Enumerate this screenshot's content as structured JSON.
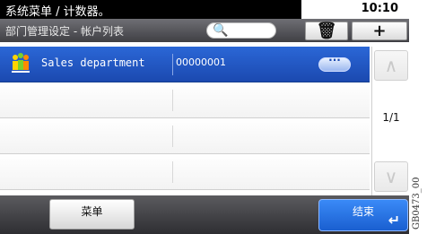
{
  "title_bar": {
    "title": "系统菜单 / 计数器。",
    "time": "10:10"
  },
  "header": {
    "subtitle": "部门管理设定 - 帐户列表",
    "search_icon": "search-icon",
    "trash_icon": "trash-icon",
    "add_icon": "plus-icon"
  },
  "accounts": {
    "rows": [
      {
        "name": "Sales department",
        "number": "00000001",
        "selected": true
      },
      {
        "name": "",
        "number": "",
        "selected": false
      },
      {
        "name": "",
        "number": "",
        "selected": false
      },
      {
        "name": "",
        "number": "",
        "selected": false
      }
    ]
  },
  "scroll": {
    "page_indicator": "1/1",
    "up_icon": "chevron-up-icon",
    "down_icon": "chevron-down-icon"
  },
  "footer": {
    "menu_label": "菜单",
    "end_label": "结束",
    "enter_icon": "enter-icon"
  },
  "side_code": "GB0473_00",
  "colors": {
    "selection_blue": "#1b49b0",
    "end_button_blue": "#2a74e6",
    "header_gray": "#4a4a4f",
    "titlebar_black": "#000000"
  }
}
